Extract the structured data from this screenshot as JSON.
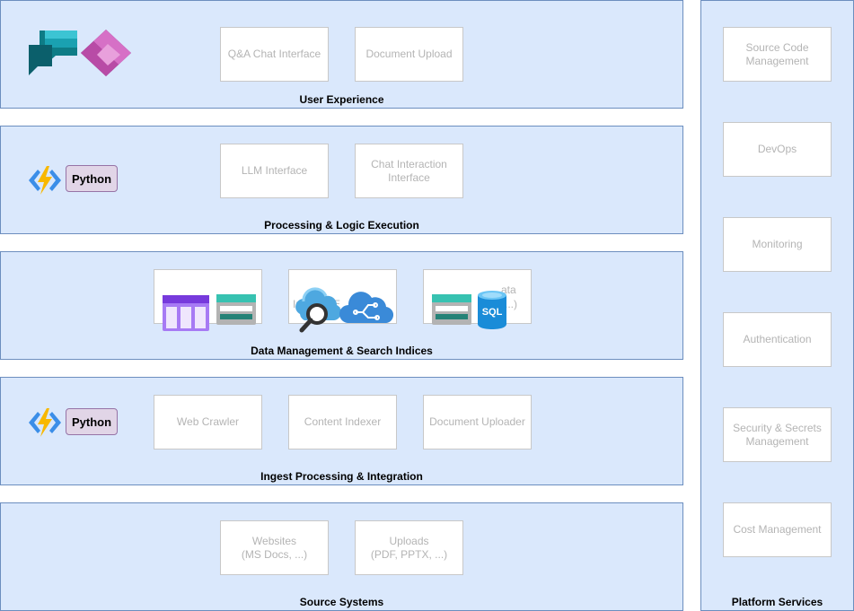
{
  "layers": {
    "user_experience": {
      "title": "User Experience",
      "components": [
        "Q&A Chat Interface",
        "Document Upload"
      ],
      "icons": [
        "power-virtual-agents-icon",
        "power-apps-icon"
      ]
    },
    "processing": {
      "title": "Processing & Logic Execution",
      "badge": "Python",
      "components": [
        "LLM Interface",
        "Chat Interaction\nInterface"
      ],
      "icons": [
        "azure-functions-icon"
      ]
    },
    "data_management": {
      "title": "Data Management & Search Indices",
      "icons": [
        "storage-table-icon",
        "storage-account-icon",
        "cognitive-search-icon",
        "cognitive-services-icon",
        "storage-account-icon",
        "sql-database-icon"
      ],
      "partial_text": {
        "box2": [
          "In",
          "E"
        ],
        "box3": [
          "ata",
          "...)"
        ]
      }
    },
    "ingest": {
      "title": "Ingest Processing & Integration",
      "badge": "Python",
      "components": [
        "Web Crawler",
        "Content Indexer",
        "Document Uploader"
      ],
      "icons": [
        "azure-functions-icon"
      ]
    },
    "source_systems": {
      "title": "Source Systems",
      "components": [
        "Websites\n(MS Docs, ...)",
        "Uploads\n(PDF, PPTX, ...)"
      ]
    }
  },
  "platform_services": {
    "title": "Platform Services",
    "items": [
      "Source Code\nManagement",
      "DevOps",
      "Monitoring",
      "Authentication",
      "Security & Secrets\nManagement",
      "Cost Management"
    ]
  },
  "colors": {
    "layer_fill": "#dae8fc",
    "layer_border": "#6c8ebf",
    "badge_fill": "#e1d5e7",
    "badge_border": "#9673a6",
    "component_text": "#b4b4b4"
  }
}
